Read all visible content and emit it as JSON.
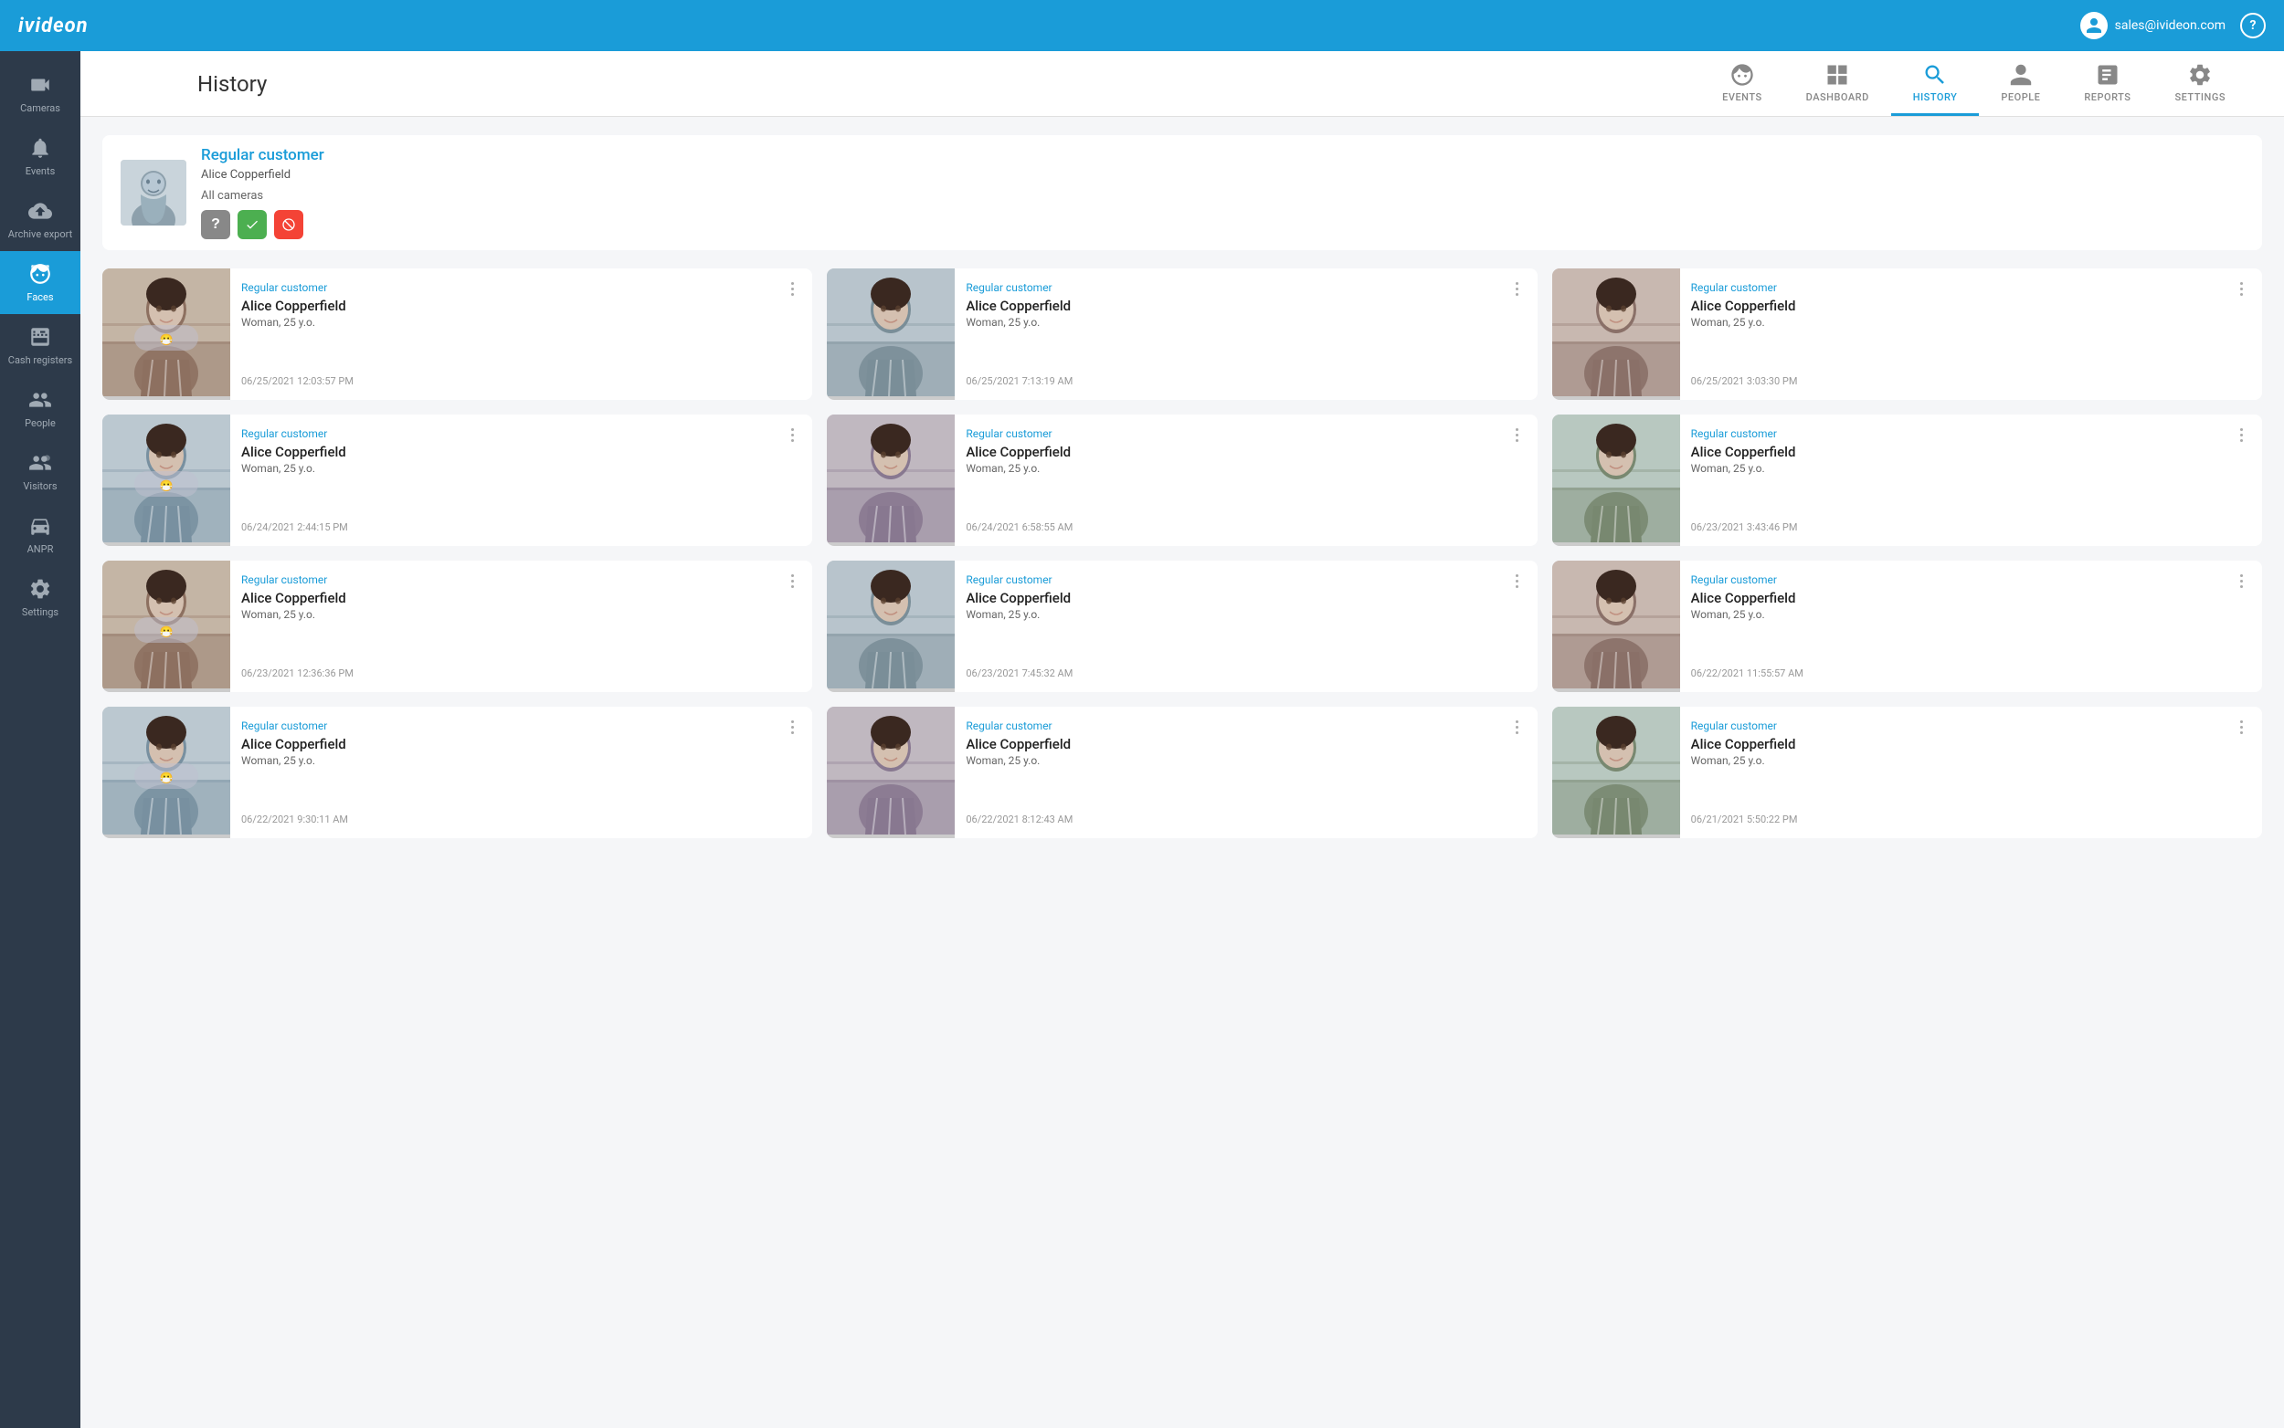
{
  "header": {
    "logo": "ivideon",
    "user_email": "sales@ivideon.com",
    "help_label": "?"
  },
  "sidebar": {
    "items": [
      {
        "id": "cameras",
        "label": "Cameras",
        "icon": "camera",
        "active": false
      },
      {
        "id": "events",
        "label": "Events",
        "icon": "bell",
        "active": false
      },
      {
        "id": "archive-export",
        "label": "Archive export",
        "icon": "cloud-upload",
        "active": false
      },
      {
        "id": "faces",
        "label": "Faces",
        "icon": "face",
        "active": true
      },
      {
        "id": "cash-registers",
        "label": "Cash registers",
        "icon": "calculator",
        "active": false
      },
      {
        "id": "people",
        "label": "People",
        "icon": "people",
        "active": false
      },
      {
        "id": "visitors",
        "label": "Visitors",
        "icon": "visitors",
        "active": false
      },
      {
        "id": "anpr",
        "label": "ANPR",
        "icon": "car",
        "active": false
      },
      {
        "id": "settings",
        "label": "Settings",
        "icon": "gear",
        "active": false
      }
    ]
  },
  "topnav": {
    "page_title": "History",
    "tabs": [
      {
        "id": "events",
        "label": "EVENTS",
        "active": false
      },
      {
        "id": "dashboard",
        "label": "DASHBOARD",
        "active": false
      },
      {
        "id": "history",
        "label": "HISTORY",
        "active": true
      },
      {
        "id": "people",
        "label": "PEOPLE",
        "active": false
      },
      {
        "id": "reports",
        "label": "REPORTS",
        "active": false
      },
      {
        "id": "settings",
        "label": "SETTINGS",
        "active": false
      }
    ]
  },
  "profile": {
    "name": "Regular customer",
    "sub_name": "Alice Copperfield",
    "cameras": "All cameras",
    "filter_btns": [
      {
        "id": "unknown",
        "label": "?",
        "type": "unknown"
      },
      {
        "id": "verified",
        "label": "✓",
        "type": "verified"
      },
      {
        "id": "blocked",
        "label": "⊘",
        "type": "blocked"
      }
    ]
  },
  "cards": [
    {
      "category": "Regular customer",
      "name": "Alice Copperfield",
      "gender": "Woman, 25 y.o.",
      "date": "06/25/2021 12:03:57 PM",
      "image_color": "#8fa8b8"
    },
    {
      "category": "Regular customer",
      "name": "Alice Copperfield",
      "gender": "Woman, 25 y.o.",
      "date": "06/25/2021 7:13:19 AM",
      "image_color": "#7a98a8"
    },
    {
      "category": "Regular customer",
      "name": "Alice Copperfield",
      "gender": "Woman, 25 y.o.",
      "date": "06/25/2021 3:03:30 PM",
      "image_color": "#8a9fb0"
    },
    {
      "category": "Regular customer",
      "name": "Alice Copperfield",
      "gender": "Woman, 25 y.o.",
      "date": "06/24/2021 2:44:15 PM",
      "image_color": "#8fa8b8"
    },
    {
      "category": "Regular customer",
      "name": "Alice Copperfield",
      "gender": "Woman, 25 y.o.",
      "date": "06/24/2021 6:58:55 AM",
      "image_color": "#7a98a8"
    },
    {
      "category": "Regular customer",
      "name": "Alice Copperfield",
      "gender": "Woman, 25 y.o.",
      "date": "06/23/2021 3:43:46 PM",
      "image_color": "#8a9fb0"
    },
    {
      "category": "Regular customer",
      "name": "Alice Copperfield",
      "gender": "Woman, 25 y.o.",
      "date": "06/23/2021 12:36:36 PM",
      "image_color": "#8fa8b8"
    },
    {
      "category": "Regular customer",
      "name": "Alice Copperfield",
      "gender": "Woman, 25 y.o.",
      "date": "06/23/2021 7:45:32 AM",
      "image_color": "#7a98a8"
    },
    {
      "category": "Regular customer",
      "name": "Alice Copperfield",
      "gender": "Woman, 25 y.o.",
      "date": "06/22/2021 11:55:57 AM",
      "image_color": "#8a9fb0"
    },
    {
      "category": "Regular customer",
      "name": "Alice Copperfield",
      "gender": "Woman, 25 y.o.",
      "date": "06/22/2021 9:30:11 AM",
      "image_color": "#8fa8b8"
    },
    {
      "category": "Regular customer",
      "name": "Alice Copperfield",
      "gender": "Woman, 25 y.o.",
      "date": "06/22/2021 8:12:43 AM",
      "image_color": "#7a98a8"
    },
    {
      "category": "Regular customer",
      "name": "Alice Copperfield",
      "gender": "Woman, 25 y.o.",
      "date": "06/21/2021 5:50:22 PM",
      "image_color": "#8a9fb0"
    }
  ],
  "colors": {
    "primary": "#1a9cd8",
    "sidebar_bg": "#2d3a4a",
    "header_bg": "#1a9cd8",
    "active_bg": "#1a9cd8"
  }
}
